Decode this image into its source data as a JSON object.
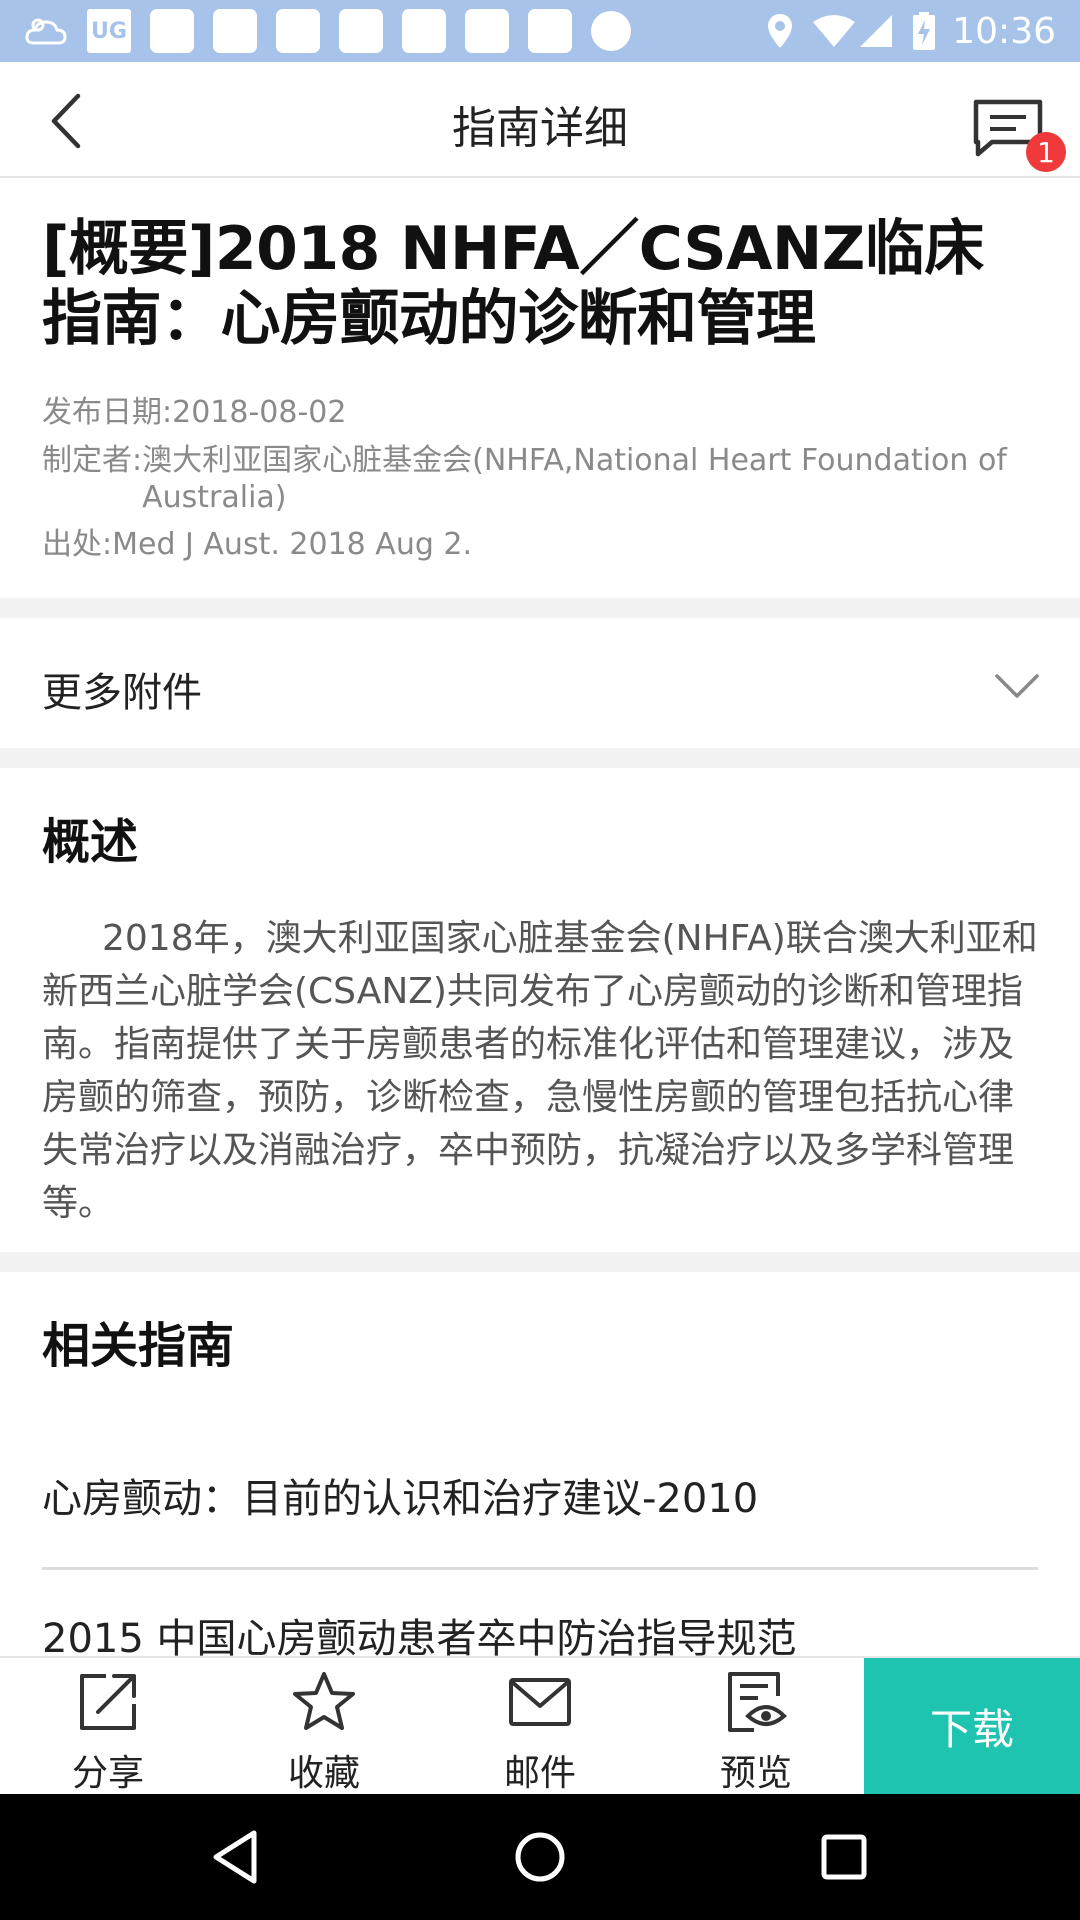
{
  "status_bar": {
    "time": "10:36",
    "left_icons": [
      "weather-icon",
      "ug-icon",
      "notification-icon",
      "notification-icon",
      "notification-icon",
      "notification-icon",
      "notification-icon",
      "notification-icon",
      "notification-icon",
      "dot-icon"
    ],
    "ug_label": "UG",
    "right_icons": [
      "location-icon",
      "wifi-icon",
      "signal-icon",
      "battery-charging-icon"
    ]
  },
  "header": {
    "title": "指南详细",
    "message_badge_count": "1"
  },
  "article": {
    "title": "[概要]2018 NHFA／CSANZ临床指南：心房颤动的诊断和管理",
    "publish_date_key": "发布日期:",
    "publish_date": "2018-08-02",
    "author_key": "制定者:",
    "author": "澳大利亚国家心脏基金会(NHFA,National Heart Foundation of Australia)",
    "source_key": "出处:",
    "source": "Med J Aust. 2018 Aug 2."
  },
  "attachments": {
    "label": "更多附件"
  },
  "overview": {
    "title": "概述",
    "text": "2018年，澳大利亚国家心脏基金会(NHFA)联合澳大利亚和新西兰心脏学会(CSANZ)共同发布了心房颤动的诊断和管理指南。指南提供了关于房颤患者的标准化评估和管理建议，涉及房颤的筛查，预防，诊断检查，急慢性房颤的管理包括抗心律失常治疗以及消融治疗，卒中预防，抗凝治疗以及多学科管理等。"
  },
  "related": {
    "title": "相关指南",
    "items": [
      "心房颤动：目前的认识和治疗建议-2010",
      "2015 中国心房颤动患者卒中防治指导规范"
    ]
  },
  "toolbar": {
    "share": "分享",
    "favorite": "收藏",
    "mail": "邮件",
    "preview": "预览",
    "download": "下载"
  },
  "colors": {
    "status_bar": "#a7c3e9",
    "accent": "#1ec4b0",
    "badge": "#f0393a"
  }
}
